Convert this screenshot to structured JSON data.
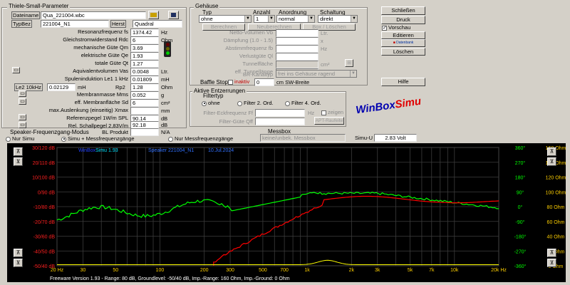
{
  "ts": {
    "title": "Thiele-Small-Parameter",
    "datei_label": "Dateiname",
    "datei_value": "Qua_221004.wbc",
    "typ_label": "TypBez",
    "typ_value": "221004_N1",
    "herst_label": "Herst",
    "herst_value": "Quadral",
    "rows": [
      {
        "label": "Resonanzfrequenz fs",
        "value": "1374.42",
        "unit": "Hz"
      },
      {
        "label": "Gleichstromwiderstand Rdc",
        "value": "6",
        "unit": "Ohm"
      },
      {
        "label": "mechanische Güte Qm",
        "value": "3.69",
        "unit": ""
      },
      {
        "label": "elektrische Güte Qe",
        "value": "1.93",
        "unit": ""
      },
      {
        "label": "totale Güte Qt",
        "value": "1.27",
        "unit": ""
      },
      {
        "label": "Aquivalentvolumen Vas",
        "value": "0.0048",
        "unit": "Ltr."
      },
      {
        "label": "Spuleninduktion Le1 1 kHz",
        "value": "0.01809",
        "unit": "mH"
      }
    ],
    "le2_label": "Le2 10kHz",
    "le2_value": "0.02129",
    "le2_unit": "mH",
    "rp2_label": "Rp2",
    "rp2_value": "1.28",
    "rp2_unit": "Ohm",
    "membran_label": "Membranmasse Mms",
    "membran_value": "0.052",
    "membran_unit": "g",
    "flaeche_label": "eff. Membranfläche Sd",
    "flaeche_value": "6",
    "flaeche_unit": "cm²",
    "xmax_label": "max.Auslenkung (einseitig) Xmax",
    "xmax_unit": "mm",
    "spl_label": "Referenzpegel 1W/m SPL",
    "spl_value": "90.14",
    "spl_unit": "dB",
    "rel_label": "Rel. Schallpegel 2,83V/m",
    "rel_value": "92.18",
    "rel_unit": "dB",
    "bl_label": "BL Produkt",
    "bl_unit": "N/A"
  },
  "gehaeuse": {
    "title": "Gehäuse",
    "typ_label": "Typ",
    "anzahl_label": "Anzahl",
    "anordnung_label": "Anordnung",
    "schaltung_label": "Schaltung",
    "typ_value": "ohne",
    "anzahl_value": "1",
    "anordnung_value": "normal",
    "schaltung_value": "direkt",
    "btn_berechnen": "Berechnen",
    "btn_neuberechnen": "Neuberechnen",
    "btn_box": "Box / Löschen",
    "rows": [
      {
        "label": "Netto-Volumen Vb",
        "unit": "Ltr."
      },
      {
        "label": "Dämpfung (1.0 - 1.5)",
        "unit": "x"
      },
      {
        "label": "Abstimmfrequenz fb",
        "unit": "Hz"
      },
      {
        "label": "Verlustgüte Ql",
        "unit": ""
      },
      {
        "label": "Tunnelfläche",
        "unit": "cm²"
      },
      {
        "label": "eff. Tunnellänge",
        "unit": "cm"
      }
    ],
    "btl_label": "BR-Kanaltyp",
    "btl_value": "frei ins Gehäuse ragend",
    "baffle_label": "Baffle Stop",
    "inaktiv_label": "inaktiv",
    "baffle_value": "0",
    "baffle_unit": "cm SW-Breite"
  },
  "buttons": {
    "schliessen": "Schließen",
    "druck": "Druck",
    "vorschau": "Vorschau",
    "editieren": "Editieren",
    "datenbank": "Datenbank",
    "loeschen": "Löschen",
    "hilfe": "Hilfe"
  },
  "filter": {
    "title": "Aktive Entzerrungen",
    "filtertyp": "Filtertyp",
    "ohne": "ohne",
    "f2": "Filter 2. Ord.",
    "f4": "Filter 4. Ord.",
    "eck_label": "Filter-Eckfrequenz Ff",
    "eck_unit": "Hz",
    "zeigen": "zeigen",
    "guete_label": "Filter-Güte Qff",
    "anpass": "APT-Raufeite"
  },
  "logo": {
    "a": "WinBox",
    "b": "Simu"
  },
  "modus": {
    "title": "Speaker-Frequenzgang-Modus",
    "nur_simu": "Nur Simu",
    "simu_mess": "Simu + Messfrequenzgänge",
    "nur_mess": "Nur Messfrequenzgänge",
    "messbox_label": "Messbox",
    "messbox_value": "keine/unbek. Messbox",
    "simu_u_label": "Simu-U",
    "simu_u_value": "2.83 Volt"
  },
  "plot": {
    "header_app_a": "WinBox",
    "header_app_b": "Simu 1.93",
    "header_name": "Speaker 221004_N1",
    "header_date": "10.Jul.2024",
    "footer": "Freeware Version 1.93 - Range: 80 dB, Groundlevel: -50/40 dB, Imp.-Range: 160 Ohm, Imp.-Ground: 0 Ohm",
    "db_ticks": [
      "30/120 dB",
      "20/110 dB",
      "10/100 dB",
      "0/90 dB",
      "-10/80 dB",
      "-20/70 dB",
      "-30/60 dB",
      "-40/50 dB",
      "-50/40 dB"
    ],
    "phase_ticks": [
      "360°",
      "270°",
      "180°",
      "90°",
      "0°",
      "-90°",
      "-180°",
      "-270°",
      "-360°"
    ],
    "ohm_ticks": [
      "160 Ohm",
      "140 Ohm",
      "120 Ohm",
      "100 Ohm",
      "80 Ohm",
      "60 Ohm",
      "40 Ohm",
      "20 Ohm",
      "0 Ohm"
    ],
    "freq_ticks": [
      "20 Hz",
      "30",
      "50",
      "100",
      "200",
      "300",
      "500",
      "700",
      "1k",
      "2k",
      "3k",
      "5k",
      "7k",
      "10k",
      "20k Hz"
    ],
    "colors": {
      "spl": "#00ff00",
      "phase": "#ff0000",
      "imp": "#ffff00",
      "grid": "#3c3c3c",
      "text": "#ff2020"
    }
  }
}
